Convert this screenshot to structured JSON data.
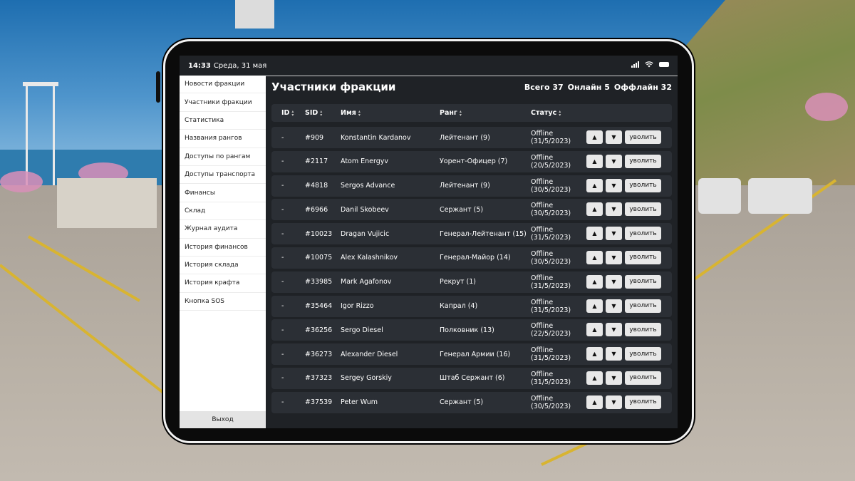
{
  "statusbar": {
    "time": "14:33",
    "date": "Среда, 31 мая"
  },
  "sidebar": {
    "items": [
      "Новости фракции",
      "Участники фракции",
      "Статистика",
      "Названия рангов",
      "Доступы по рангам",
      "Доступы транспорта",
      "Финансы",
      "Склад",
      "Журнал аудита",
      "История финансов",
      "История склада",
      "История крафта",
      "Кнопка SOS"
    ],
    "logout": "Выход"
  },
  "main": {
    "title": "Участники фракции",
    "total": "Всего 37",
    "online": "Онлайн 5",
    "offline": "Оффлайн 32"
  },
  "table": {
    "headers": {
      "id": "ID",
      "sid": "SID",
      "name": "Имя",
      "rank": "Ранг",
      "status": "Статус"
    },
    "up_icon": "▲",
    "down_icon": "▼",
    "fire_label": "уволить",
    "rows": [
      {
        "id": "-",
        "sid": "#909",
        "name": "Konstantin Kardanov",
        "rank": "Лейтенант (9)",
        "status": "Offline",
        "date": "(31/5/2023)"
      },
      {
        "id": "-",
        "sid": "#2117",
        "name": "Atom Energyv",
        "rank": "Уорент-Офицер (7)",
        "status": "Offline",
        "date": "(20/5/2023)"
      },
      {
        "id": "-",
        "sid": "#4818",
        "name": "Sergos Advance",
        "rank": "Лейтенант (9)",
        "status": "Offline",
        "date": "(30/5/2023)"
      },
      {
        "id": "-",
        "sid": "#6966",
        "name": "Danil Skobeev",
        "rank": "Сержант (5)",
        "status": "Offline",
        "date": "(30/5/2023)"
      },
      {
        "id": "-",
        "sid": "#10023",
        "name": "Dragan Vujicic",
        "rank": "Генерал-Лейтенант (15)",
        "status": "Offline",
        "date": "(31/5/2023)"
      },
      {
        "id": "-",
        "sid": "#10075",
        "name": "Alex Kalashnikov",
        "rank": "Генерал-Майор (14)",
        "status": "Offline",
        "date": "(30/5/2023)"
      },
      {
        "id": "-",
        "sid": "#33985",
        "name": "Mark Agafonov",
        "rank": "Рекрут (1)",
        "status": "Offline",
        "date": "(31/5/2023)"
      },
      {
        "id": "-",
        "sid": "#35464",
        "name": "Igor Rizzo",
        "rank": "Капрал (4)",
        "status": "Offline",
        "date": "(31/5/2023)"
      },
      {
        "id": "-",
        "sid": "#36256",
        "name": "Sergo Diesel",
        "rank": "Полковник (13)",
        "status": "Offline",
        "date": "(22/5/2023)"
      },
      {
        "id": "-",
        "sid": "#36273",
        "name": "Alexander Diesel",
        "rank": "Генерал Армии (16)",
        "status": "Offline",
        "date": "(31/5/2023)"
      },
      {
        "id": "-",
        "sid": "#37323",
        "name": "Sergey Gorskiy",
        "rank": "Штаб Сержант (6)",
        "status": "Offline",
        "date": "(31/5/2023)"
      },
      {
        "id": "-",
        "sid": "#37539",
        "name": "Peter Wum",
        "rank": "Сержант (5)",
        "status": "Offline",
        "date": "(30/5/2023)"
      }
    ]
  },
  "colors": {
    "panel": "#1f2226",
    "row": "#2b2f35",
    "sidebar": "#ffffff",
    "button": "#e8e8e8"
  }
}
